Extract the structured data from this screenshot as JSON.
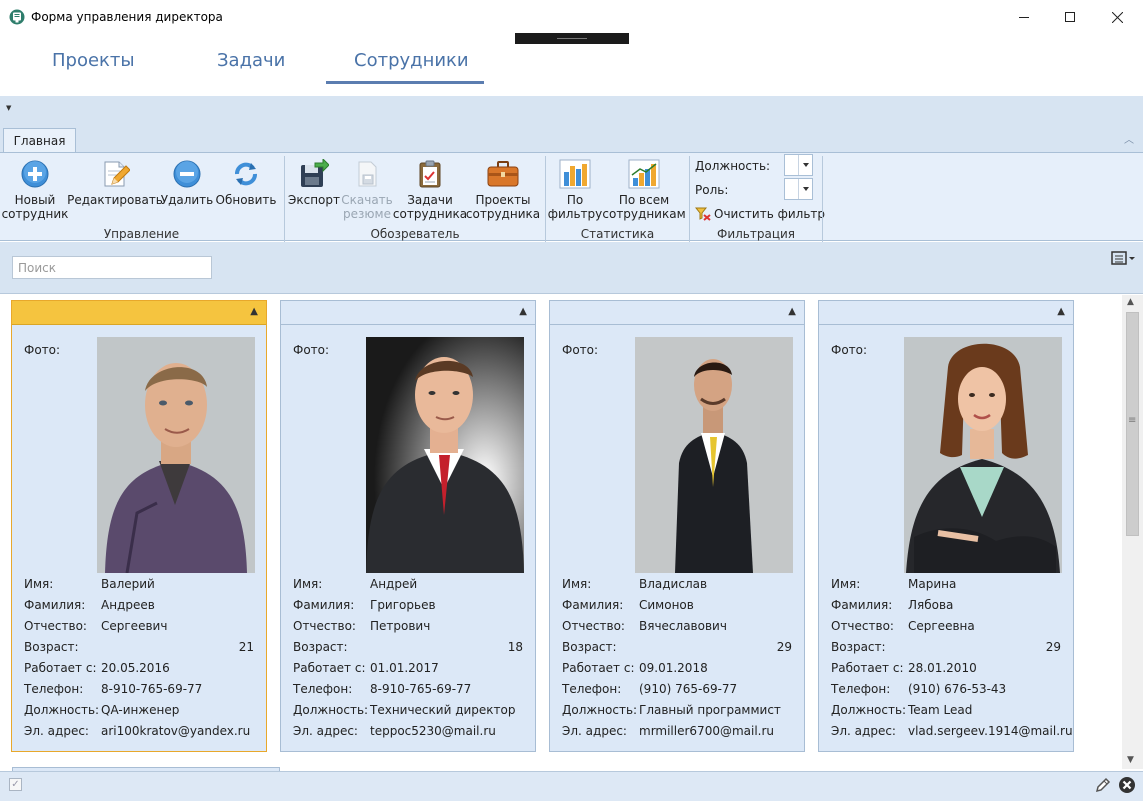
{
  "window": {
    "title": "Форма управления директора"
  },
  "nav_tabs": [
    {
      "label": "Проекты"
    },
    {
      "label": "Задачи"
    },
    {
      "label": "Сотрудники"
    }
  ],
  "nav_active": "Сотрудники",
  "ribbon": {
    "tab": "Главная",
    "groups": {
      "manage": {
        "label": "Управление",
        "new": [
          "Новый",
          "сотрудник"
        ],
        "edit": "Редактировать",
        "delete": "Удалить",
        "refresh": "Обновить"
      },
      "browser": {
        "label": "Обозреватель",
        "export": "Экспорт",
        "resume": [
          "Скачать",
          "резюме"
        ],
        "tasks": [
          "Задачи",
          "сотрудника"
        ],
        "projects": [
          "Проекты",
          "сотрудника"
        ]
      },
      "stats": {
        "label": "Статистика",
        "by_filter": [
          "По",
          "фильтру"
        ],
        "by_all": [
          "По всем",
          "сотрудникам"
        ]
      },
      "filter": {
        "label": "Фильтрация",
        "position": "Должность:",
        "role": "Роль:",
        "clear": "Очистить фильтр"
      }
    }
  },
  "search": {
    "placeholder": "Поиск"
  },
  "field_labels": {
    "photo": "Фото:",
    "name": "Имя:",
    "surname": "Фамилия:",
    "patronymic": "Отчество:",
    "age": "Возраст:",
    "since": "Работает с:",
    "phone": "Телефон:",
    "position": "Должность:",
    "email": "Эл. адрес:"
  },
  "employees": [
    {
      "name": "Валерий",
      "surname": "Андреев",
      "patronymic": "Сергеевич",
      "age": "21",
      "since": "20.05.2016",
      "phone": "8-910-765-69-77",
      "position": "QA-инженер",
      "email": "ari100kratov@yandex.ru",
      "selected": true
    },
    {
      "name": "Андрей",
      "surname": "Григорьев",
      "patronymic": "Петрович",
      "age": "18",
      "since": "01.01.2017",
      "phone": "8-910-765-69-77",
      "position": "Технический директор",
      "email": "teppoc5230@mail.ru",
      "selected": false
    },
    {
      "name": "Владислав",
      "surname": "Симонов",
      "patronymic": "Вячеславович",
      "age": "29",
      "since": "09.01.2018",
      "phone": "(910) 765-69-77",
      "position": "Главный программист",
      "email": "mrmiller6700@mail.ru",
      "selected": false
    },
    {
      "name": "Марина",
      "surname": "Лябова",
      "patronymic": "Сергеевна",
      "age": "29",
      "since": "28.01.2010",
      "phone": "(910) 676-53-43",
      "position": "Team Lead",
      "email": "vlad.sergeev.1914@mail.ru",
      "selected": false
    }
  ],
  "colors": {
    "accent": "#4a73a8",
    "selected_header": "#f5c43f",
    "card_bg": "#dce8f7",
    "ribbon_bg": "#e6effa"
  }
}
